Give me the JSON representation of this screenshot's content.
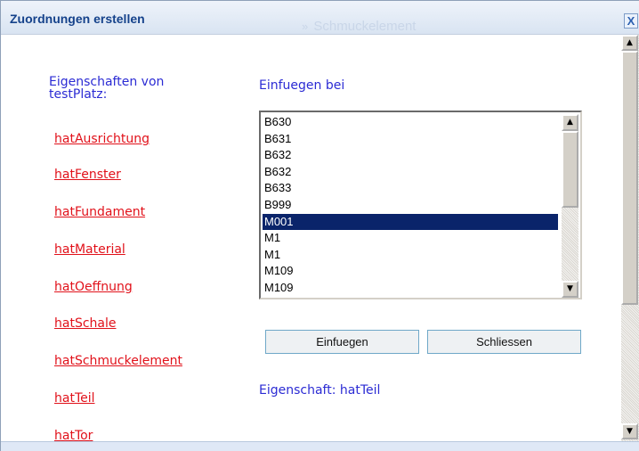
{
  "window": {
    "title": "Zuordnungen erstellen",
    "background_title_icon": "»",
    "background_title": "Schmuckelement",
    "close_label": "X"
  },
  "properties": {
    "header": "Eigenschaften von testPlatz:",
    "items": [
      "hatAusrichtung",
      "hatFenster",
      "hatFundament",
      "hatMaterial",
      "hatOeffnung",
      "hatSchale",
      "hatSchmuckelement",
      "hatTeil",
      "hatTor"
    ]
  },
  "insert": {
    "label": "Einfuegen bei",
    "options": [
      "B630",
      "B631",
      "B632",
      "B632",
      "B633",
      "B999",
      "M001",
      "M1",
      "M1",
      "M109",
      "M109"
    ],
    "selected_index": 6
  },
  "buttons": {
    "insert_label": "Einfuegen",
    "close_label": "Schliessen"
  },
  "status": {
    "text": "Eigenschaft: hatTeil"
  },
  "colors": {
    "link": "#e1111a",
    "label": "#2b2bd4",
    "title": "#15428b",
    "selection": "#0a246a"
  },
  "icons": {
    "scroll_up": "scroll-up-arrow-icon",
    "scroll_down": "scroll-down-arrow-icon",
    "close": "close-icon"
  }
}
